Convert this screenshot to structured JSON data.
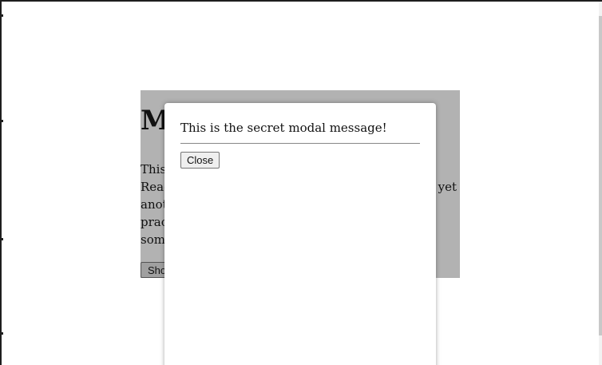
{
  "page": {
    "heading": "M",
    "paragraph_lines": [
      {
        "left": "This",
        "right": ""
      },
      {
        "left": "Reac",
        "right": "yet"
      },
      {
        "left": "anot",
        "right": ""
      },
      {
        "left": "prac",
        "right": ""
      },
      {
        "left": "som",
        "right": ""
      }
    ],
    "show_button_label": "Sho"
  },
  "modal": {
    "message": "This is the secret modal message!",
    "close_label": "Close"
  }
}
